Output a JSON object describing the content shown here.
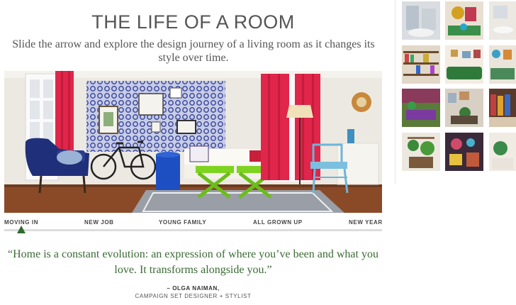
{
  "page": {
    "title": "THE LIFE OF A ROOM",
    "subtitle": "Slide the arrow and explore the design journey of a living room as it changes its style over time."
  },
  "timeline": {
    "stages": [
      "MOVING IN",
      "NEW JOB",
      "YOUNG FAMILY",
      "ALL GROWN UP",
      "NEW YEAR"
    ],
    "active_stage": "MOVING IN"
  },
  "quote": {
    "text": "“Home is a constant evolution: an expression of where you’ve been and what you love. It transforms alongside you.”",
    "author": "– OLGA NAIMAN,",
    "role": "CAMPAIGN SET DESIGNER + STYLIST"
  },
  "colors": {
    "accent_green": "#3a6b34",
    "arrow_green": "#2f6b2f",
    "curtain_red": "#e0264a",
    "sofa_blue": "#1f2f7a",
    "table_green": "#7ed321"
  },
  "thumbnails": [
    "room-thumbnail",
    "room-thumbnail",
    "room-thumbnail",
    "room-thumbnail",
    "room-thumbnail",
    "room-thumbnail",
    "room-thumbnail",
    "room-thumbnail",
    "room-thumbnail",
    "room-thumbnail",
    "room-thumbnail",
    "room-thumbnail"
  ]
}
